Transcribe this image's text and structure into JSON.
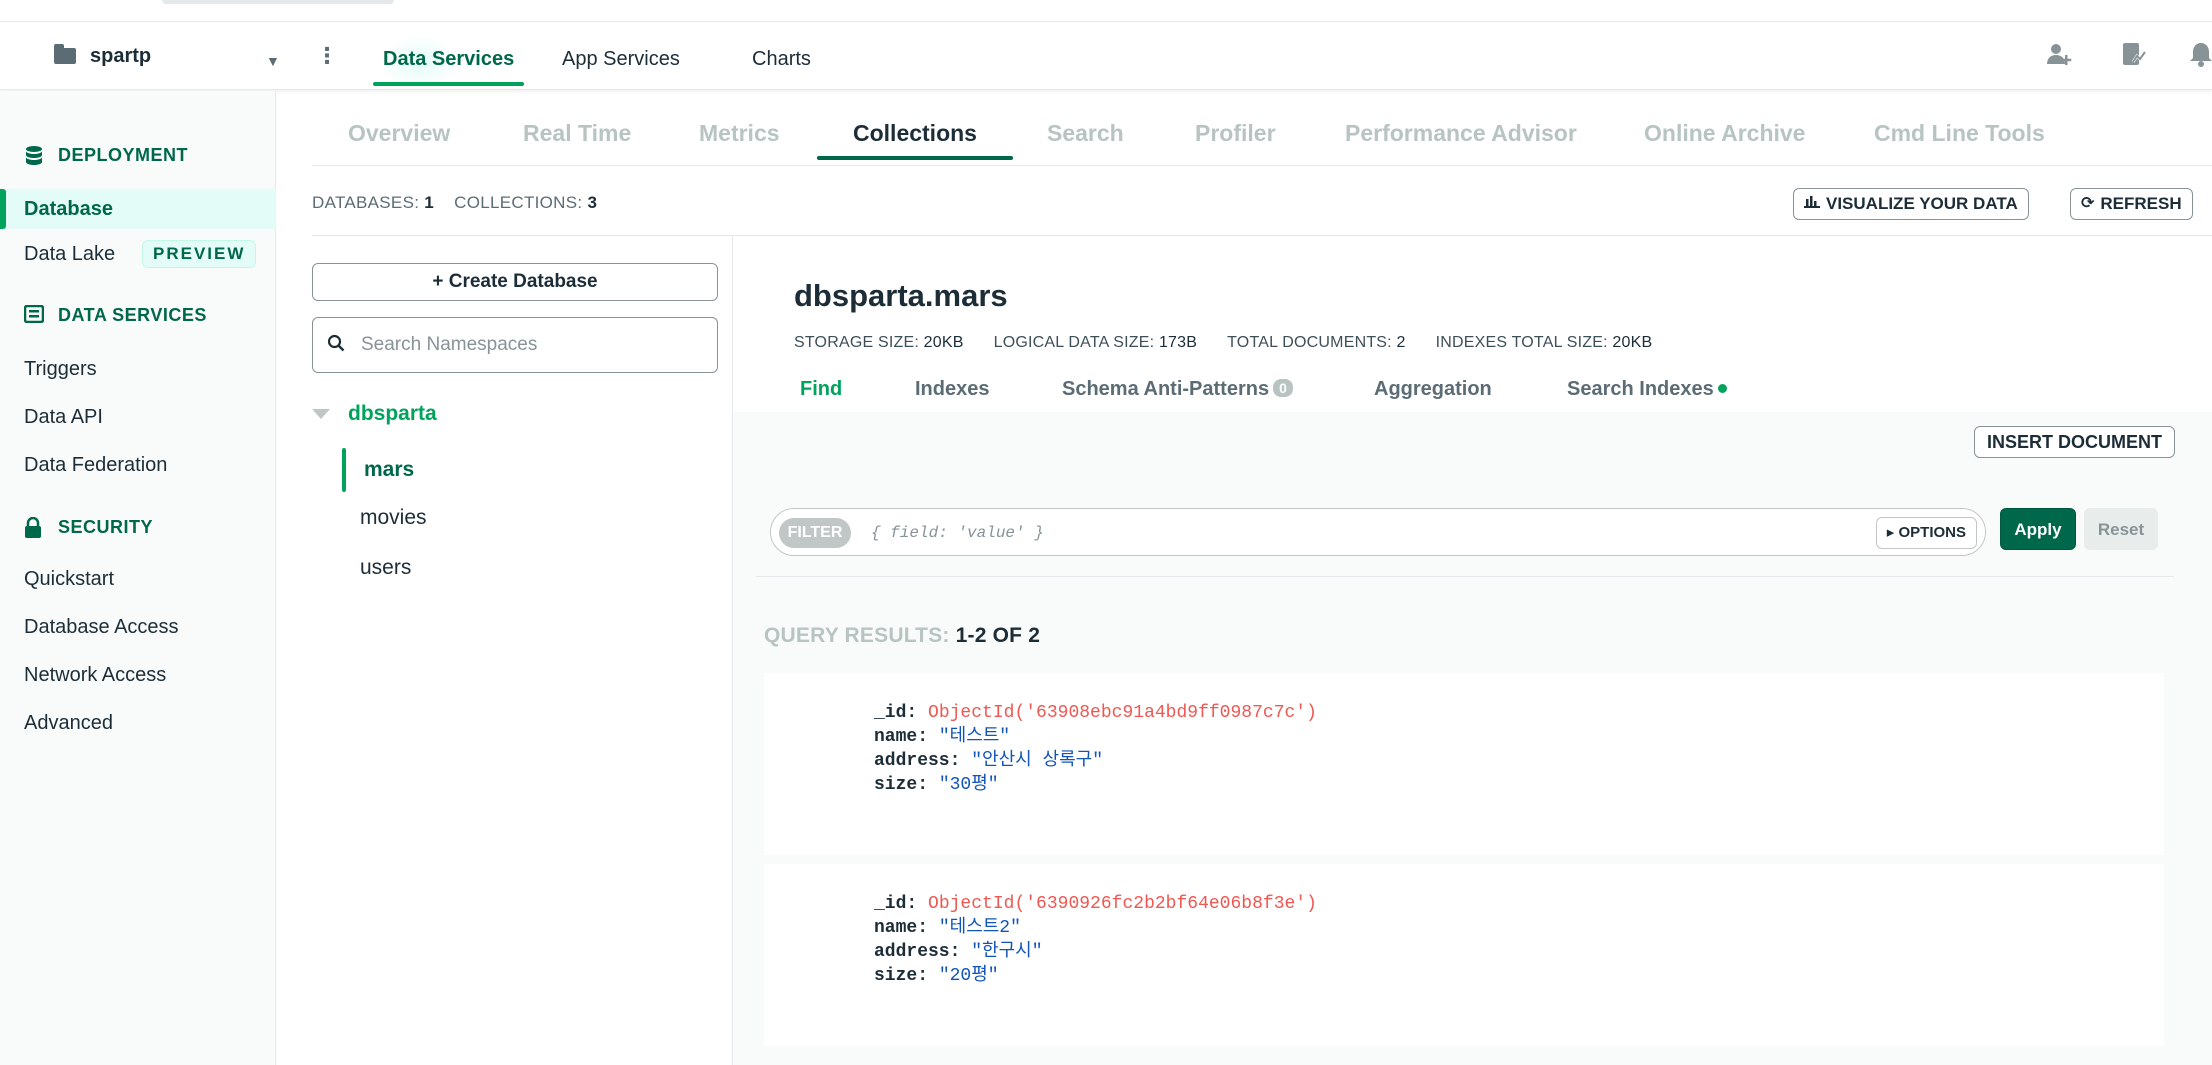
{
  "header": {
    "project_name": "spartp",
    "nav_tabs": [
      {
        "label": "Data Services",
        "active": true
      },
      {
        "label": "App Services",
        "active": false
      },
      {
        "label": "Charts",
        "active": false
      }
    ],
    "icons": [
      "invite-user-icon",
      "activity-icon",
      "notifications-bell-icon"
    ]
  },
  "sidebar": {
    "sections": [
      {
        "title": "DEPLOYMENT",
        "icon": "database-icon"
      },
      {
        "title": "DATA SERVICES",
        "icon": "data-services-icon"
      },
      {
        "title": "SECURITY",
        "icon": "lock-icon"
      }
    ],
    "items": {
      "database": "Database",
      "data_lake": "Data Lake",
      "data_lake_badge": "PREVIEW",
      "triggers": "Triggers",
      "data_api": "Data API",
      "data_federation": "Data Federation",
      "quickstart": "Quickstart",
      "database_access": "Database Access",
      "network_access": "Network Access",
      "advanced": "Advanced"
    }
  },
  "subtabs": {
    "overview": "Overview",
    "real_time": "Real Time",
    "metrics": "Metrics",
    "collections": "Collections",
    "search": "Search",
    "profiler": "Profiler",
    "performance_advisor": "Performance Advisor",
    "online_archive": "Online Archive",
    "cmd_line_tools": "Cmd Line Tools",
    "active": "Collections"
  },
  "counts": {
    "databases_label": "DATABASES:",
    "databases_value": "1",
    "collections_label": "COLLECTIONS:",
    "collections_value": "3"
  },
  "actions": {
    "visualize": "VISUALIZE YOUR DATA",
    "refresh": "REFRESH",
    "create_database": "+ Create Database",
    "search_placeholder": "Search Namespaces",
    "insert_document": "INSERT DOCUMENT",
    "apply": "Apply",
    "reset": "Reset",
    "options": "OPTIONS",
    "filter_chip": "FILTER",
    "filter_placeholder": "{ field: 'value' }"
  },
  "tree": {
    "database": "dbsparta",
    "collections": [
      "mars",
      "movies",
      "users"
    ],
    "active_collection": "mars"
  },
  "collection": {
    "title": "dbsparta.mars",
    "stats": {
      "storage_size_label": "STORAGE SIZE:",
      "storage_size": "20KB",
      "logical_size_label": "LOGICAL DATA SIZE:",
      "logical_size": "173B",
      "total_docs_label": "TOTAL DOCUMENTS:",
      "total_docs": "2",
      "indexes_size_label": "INDEXES TOTAL SIZE:",
      "indexes_size": "20KB"
    },
    "tabs": {
      "find": "Find",
      "indexes": "Indexes",
      "schema": "Schema Anti-Patterns",
      "schema_count": "0",
      "aggregation": "Aggregation",
      "search_indexes": "Search Indexes"
    }
  },
  "results": {
    "label": "QUERY RESULTS:",
    "range": "1-2 OF 2",
    "documents": [
      {
        "id_key": "_id:",
        "id_value": "ObjectId('63908ebc91a4bd9ff0987c7c')",
        "name_key": "name:",
        "name_value": "\"테스트\"",
        "address_key": "address:",
        "address_value": "\"안산시 상록구\"",
        "size_key": "size:",
        "size_value": "\"30평\""
      },
      {
        "id_key": "_id:",
        "id_value": "ObjectId('6390926fc2b2bf64e06b8f3e')",
        "name_key": "name:",
        "name_value": "\"테스트2\"",
        "address_key": "address:",
        "address_value": "\"한구시\"",
        "size_key": "size:",
        "size_value": "\"20평\""
      }
    ]
  },
  "colors": {
    "brand_green": "#00684a",
    "accent_green": "#00a35c",
    "objectid_red": "#ef5752",
    "string_blue": "#1254b7"
  }
}
